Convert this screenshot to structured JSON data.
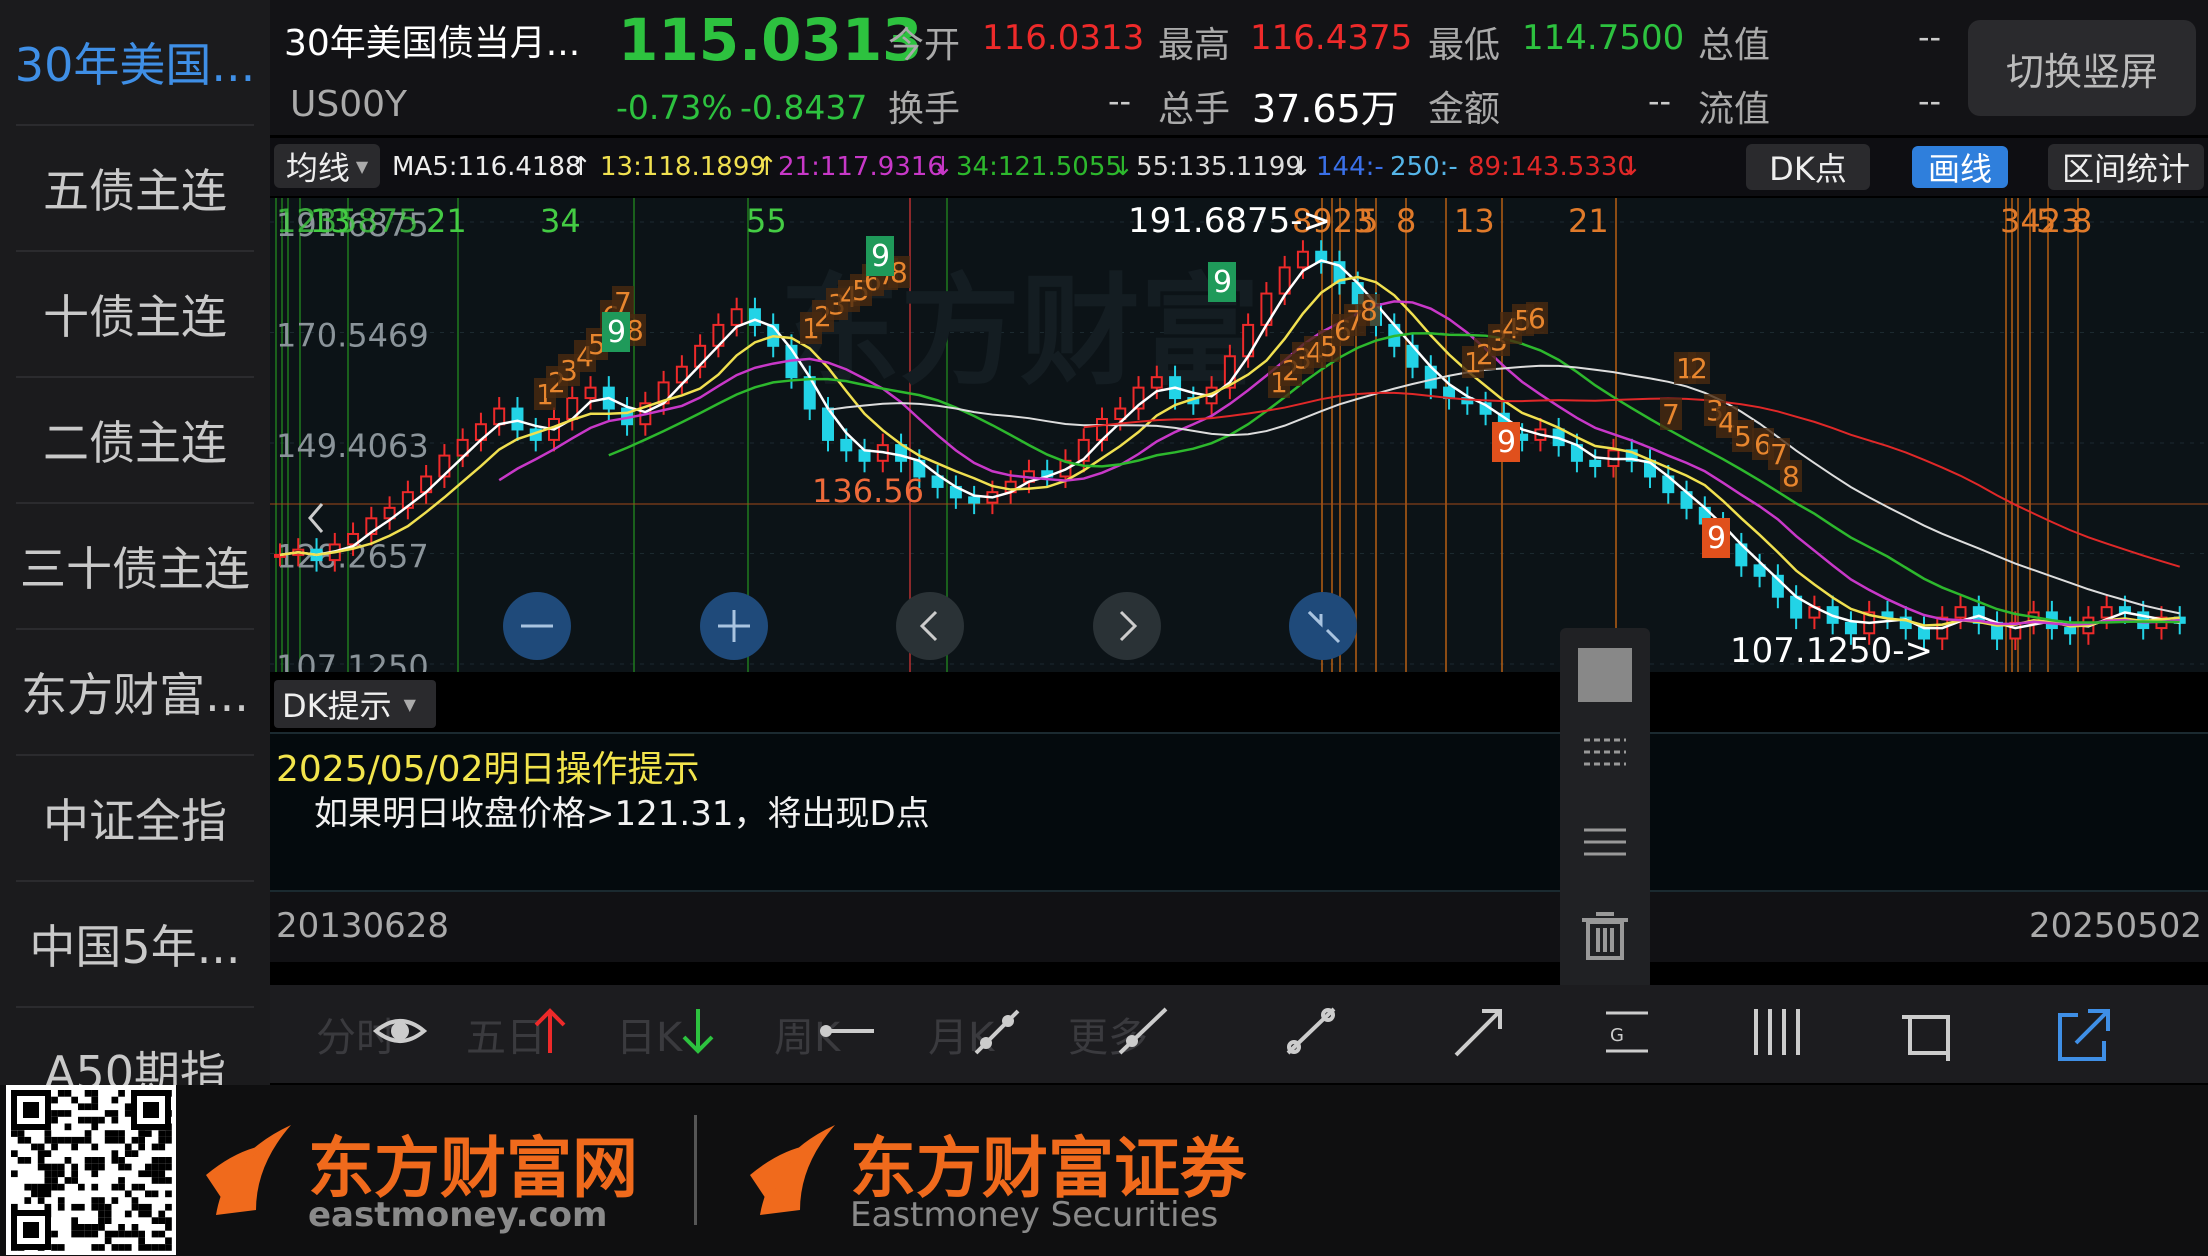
{
  "sidebar": {
    "items": [
      {
        "label": "30年美国..."
      },
      {
        "label": "五债主连"
      },
      {
        "label": "十债主连"
      },
      {
        "label": "二债主连"
      },
      {
        "label": "三十债主连"
      },
      {
        "label": "东方财富..."
      },
      {
        "label": "中证全指"
      },
      {
        "label": "中国5年..."
      },
      {
        "label": "A50期指"
      }
    ]
  },
  "header": {
    "name": "30年美国债当月...",
    "code": "US00Y",
    "price": "115.0313",
    "change_pct": "-0.73%",
    "change_val": "-0.8437",
    "open_label": "今开",
    "open_value": "116.0313",
    "high_label": "最高",
    "high_value": "116.4375",
    "low_label": "最低",
    "low_value": "114.7500",
    "total_value_label": "总值",
    "total_value_value": "--",
    "turnover_label": "换手",
    "turnover_value": "--",
    "volume_label": "总手",
    "volume_value": "37.65万",
    "amount_label": "金额",
    "amount_value": "--",
    "float_label": "流值",
    "float_value": "--",
    "switch_label": "切换竖屏"
  },
  "ma_row": {
    "selector": "均线",
    "ma5": "MA5:116.4188",
    "ma13": "13:118.1899",
    "ma21": "21:117.9316",
    "ma34": "34:121.5055",
    "ma55": "55:135.1199",
    "ma144": "144:-",
    "ma250": "250:-",
    "ma89": "89:143.5330",
    "dk_label": "DK点",
    "draw_label": "画线",
    "range_label": "区间统计"
  },
  "chart_data": {
    "type": "candlestick",
    "y_ticks": [
      "191.6875",
      "170.5469",
      "149.4063",
      "128.2657",
      "107.1250"
    ],
    "ylim": [
      107.125,
      191.6875
    ],
    "fib_labels_green": [
      "13",
      "21",
      "34",
      "55"
    ],
    "fib_labels_orange_right": [
      "5",
      "8",
      "13",
      "21",
      "5",
      "8"
    ],
    "annotations": {
      "max_label": "191.6875->",
      "min_label": "107.1250->",
      "mid_label": "136.56"
    },
    "buttons": [
      "zoom-out",
      "zoom-in",
      "pan-left",
      "pan-right",
      "fit"
    ]
  },
  "indicator": {
    "selector": "DK提示",
    "tip_title": "2025/05/02明日操作提示",
    "tip_text": "如果明日收盘价格>121.31，将出现D点"
  },
  "dates": {
    "start": "20130628",
    "end": "20250502"
  },
  "bottom_tabs_ghost": [
    "分时",
    "五日",
    "日K",
    "周K",
    "月K",
    "更多"
  ],
  "footer": {
    "brand1_cn": "东方财富网",
    "brand1_en": "eastmoney.com",
    "brand2_cn": "东方财富证券",
    "brand2_en": "Eastmoney Securities"
  },
  "colors": {
    "up": "#ee2a2a",
    "down": "#22d3e6",
    "green": "#2dc23f",
    "accent": "#3f8fe6",
    "orange": "#e87a1c"
  }
}
